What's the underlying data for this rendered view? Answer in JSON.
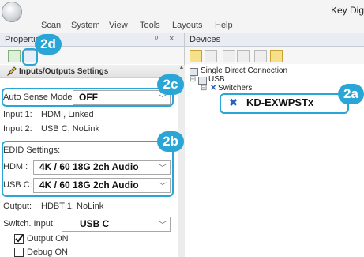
{
  "app": {
    "title": "Key Dig"
  },
  "menu": {
    "items": [
      "Scan",
      "System",
      "View",
      "Tools",
      "Layouts",
      "Help"
    ]
  },
  "properties": {
    "title": "Properties",
    "header_buttons": [
      "ᵖ",
      "×"
    ],
    "section_title": "Inputs/Outputs Settings",
    "auto_sense_label": "Auto Sense Mode:",
    "auto_sense_value": "OFF",
    "input1_label": "Input 1:",
    "input1_value": "HDMI, Linked",
    "input2_label": "Input 2:",
    "input2_value": "USB C, NoLink",
    "edid_label": "EDID Settings:",
    "hdmi_label": "HDMI:",
    "hdmi_value": "4K / 60 18G 2ch Audio",
    "usbc_label": "USB C:",
    "usbc_value": "4K / 60 18G 2ch Audio",
    "output_label": "Output:",
    "output_value": "HDBT 1, NoLink",
    "switch_label": "Switch. Input:",
    "switch_value": "USB C",
    "output_on_label": "Output ON",
    "output_on_checked": true,
    "debug_on_label": "Debug ON",
    "debug_on_checked": false
  },
  "devices": {
    "title": "Devices",
    "tree": {
      "root": "Single Direct Connection",
      "usb": "USB",
      "switchers": "Switchers",
      "device": "KD-EXWPSTx"
    }
  },
  "callouts": {
    "a": "2a",
    "b": "2b",
    "c": "2c",
    "d": "2d"
  },
  "colors": {
    "callout": "#2aa6d6",
    "menu_bg": "#f4f4f4",
    "panel_header": "#e9ecf3"
  }
}
